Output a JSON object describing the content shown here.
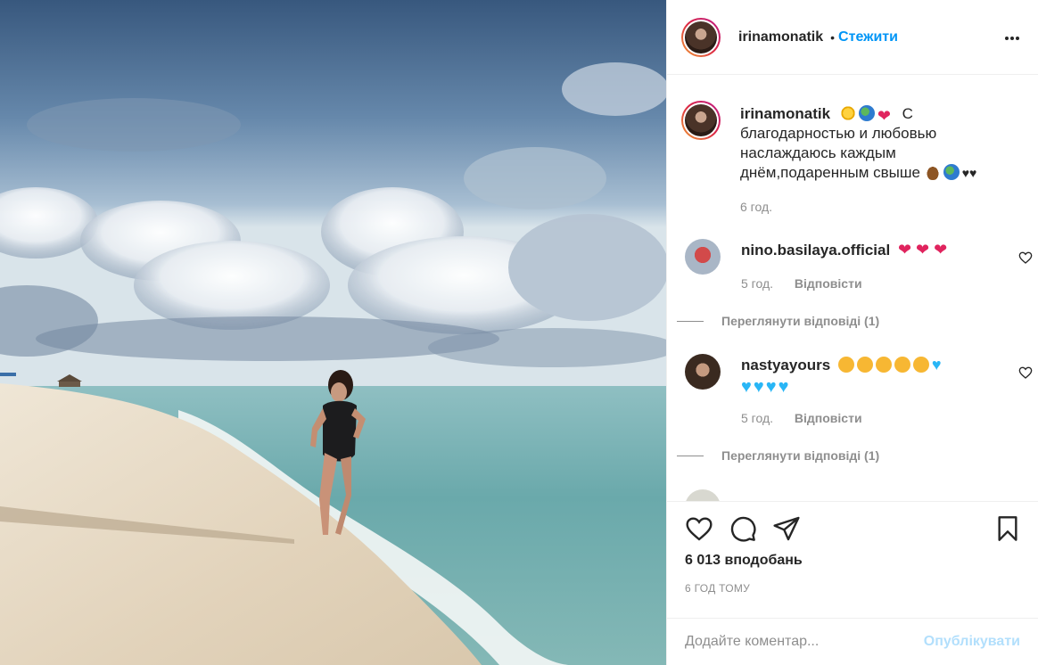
{
  "header": {
    "username": "irinamonatik",
    "separator": "•",
    "follow_label": "Стежити",
    "more_label": "•••"
  },
  "caption": {
    "username": "irinamonatik",
    "text": "С благодарностью и любовью наслаждаюсь каждым днём,подаренным свыше",
    "time": "6 год."
  },
  "comments": [
    {
      "username": "nino.basilaya.official",
      "emoji": [
        "red-heart",
        "red-heart",
        "red-heart"
      ],
      "time": "5 год.",
      "reply_label": "Відповісти",
      "view_replies": "Переглянути відповіді (1)"
    },
    {
      "username": "nastyayours",
      "emoji": [
        "heart-eyes",
        "heart-eyes",
        "heart-eyes",
        "heart-eyes",
        "heart-eyes",
        "blue-heart",
        "blue-heart",
        "blue-heart",
        "blue-heart",
        "blue-heart"
      ],
      "time": "5 год.",
      "reply_label": "Відповісти",
      "view_replies": "Переглянути відповіді (1)"
    }
  ],
  "actions": {
    "likes": "6 013 вподобань",
    "posted_ago": "6 ГОД ТОМУ"
  },
  "add_comment": {
    "placeholder": "Додайте коментар...",
    "post_label": "Опублікувати"
  },
  "colors": {
    "accent": "#0095f6",
    "post_disabled": "#b2dffc",
    "muted": "#8e8e8e"
  }
}
